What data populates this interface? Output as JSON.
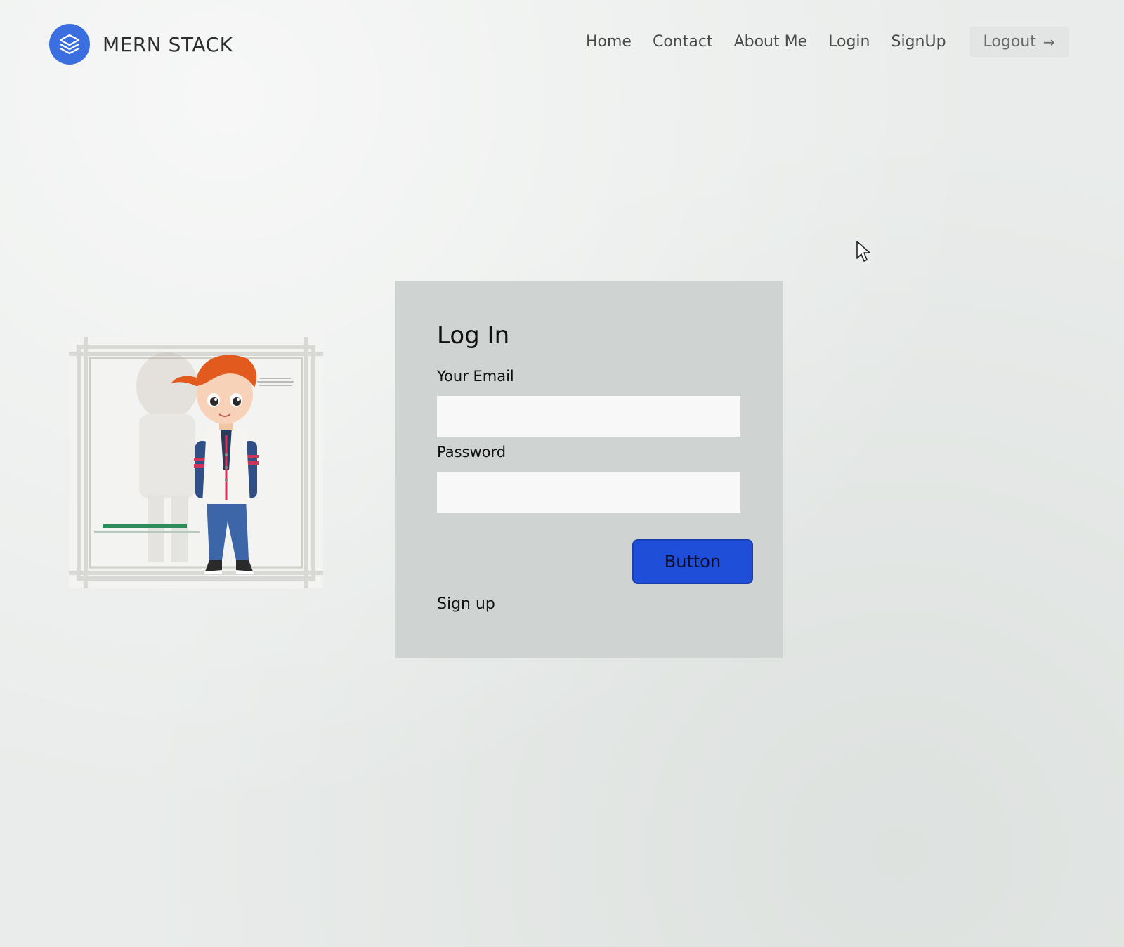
{
  "header": {
    "brand_name": "MERN STACK",
    "logo_icon": "layers-icon",
    "brand_color": "#3b6fe0",
    "nav": [
      {
        "label": "Home"
      },
      {
        "label": "Contact"
      },
      {
        "label": "About Me"
      },
      {
        "label": "Login"
      },
      {
        "label": "SignUp"
      }
    ],
    "logout_label": "Logout",
    "logout_icon": "arrow-right-icon"
  },
  "login_form": {
    "title": "Log In",
    "email_label": "Your Email",
    "email_value": "",
    "password_label": "Password",
    "password_value": "",
    "submit_label": "Button",
    "submit_color": "#1f4fd8",
    "signup_link": "Sign up"
  },
  "illustration": {
    "icon": "cartoon-boy-illustration"
  }
}
